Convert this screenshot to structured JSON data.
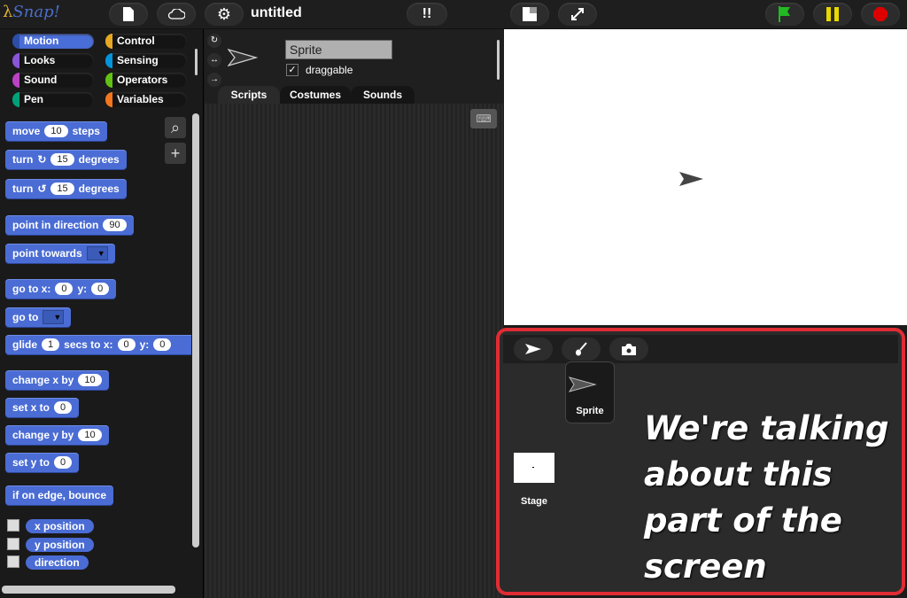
{
  "app": {
    "logo": "Snap!",
    "project_title": "untitled"
  },
  "toolbar": {
    "icons": [
      "file-icon",
      "cloud-icon",
      "settings-gear-icon",
      "footprints-icon",
      "stage-size-icon",
      "fullscreen-icon",
      "green-flag-icon",
      "pause-icon",
      "stop-icon"
    ],
    "colors": {
      "flag": "#22bb22",
      "pause": "#e8d800",
      "stop": "#dd0000"
    }
  },
  "categories": [
    {
      "label": "Motion",
      "color": "#4a6cd4",
      "selected": true
    },
    {
      "label": "Control",
      "color": "#e6a822",
      "selected": false
    },
    {
      "label": "Looks",
      "color": "#8a55d7",
      "selected": false
    },
    {
      "label": "Sensing",
      "color": "#0494dc",
      "selected": false
    },
    {
      "label": "Sound",
      "color": "#bb42c3",
      "selected": false
    },
    {
      "label": "Operators",
      "color": "#62c213",
      "selected": false
    },
    {
      "label": "Pen",
      "color": "#00a178",
      "selected": false
    },
    {
      "label": "Variables",
      "color": "#f3761d",
      "selected": false
    }
  ],
  "blocks": {
    "move": {
      "a": "move",
      "v": "10",
      "b": "steps"
    },
    "turn_cw": {
      "a": "turn",
      "v": "15",
      "b": "degrees"
    },
    "turn_ccw": {
      "a": "turn",
      "v": "15",
      "b": "degrees"
    },
    "point_dir": {
      "a": "point in direction",
      "v": "90"
    },
    "point_towards": {
      "a": "point towards"
    },
    "goto_xy": {
      "a": "go to x:",
      "x": "0",
      "b": "y:",
      "y": "0"
    },
    "goto": {
      "a": "go to"
    },
    "glide": {
      "a": "glide",
      "v": "1",
      "b": "secs to x:",
      "x": "0",
      "c": "y:",
      "y": "0"
    },
    "change_x": {
      "a": "change x by",
      "v": "10"
    },
    "set_x": {
      "a": "set x to",
      "v": "0"
    },
    "change_y": {
      "a": "change y by",
      "v": "10"
    },
    "set_y": {
      "a": "set y to",
      "v": "0"
    },
    "bounce": {
      "a": "if on edge, bounce"
    }
  },
  "reporters": [
    "x position",
    "y position",
    "direction"
  ],
  "sprite": {
    "name": "Sprite",
    "draggable_label": "draggable",
    "draggable": true
  },
  "tabs": [
    {
      "label": "Scripts",
      "active": true
    },
    {
      "label": "Costumes",
      "active": false
    },
    {
      "label": "Sounds",
      "active": false
    }
  ],
  "corral": {
    "sprite_label": "Sprite",
    "stage_label": "Stage",
    "highlight_color": "#e02c34"
  },
  "annotation": {
    "text": "We're talking about this part of the screen"
  }
}
